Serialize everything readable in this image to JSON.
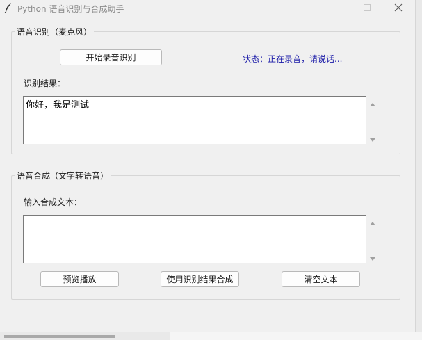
{
  "window": {
    "title": "Python 语音识别与合成助手",
    "controls": {
      "minimize": "minimize-icon",
      "maximize": "maximize-icon",
      "close": "close-icon"
    }
  },
  "recognize": {
    "frame_title": "语音识别（麦克风）",
    "start_button": "开始录音识别",
    "status": "状态：正在录音，请说话...",
    "result_label": "识别结果：",
    "result_text": "你好，我是测试"
  },
  "synth": {
    "frame_title": "语音合成（文字转语音）",
    "input_label": "输入合成文本：",
    "input_text": "",
    "buttons": {
      "preview": "预览播放",
      "use_result": "使用识别结果合成",
      "clear": "清空文本"
    }
  },
  "colors": {
    "status": "#1a1aa8",
    "window_bg": "#f0f0f0",
    "border": "#d6d6d6"
  }
}
